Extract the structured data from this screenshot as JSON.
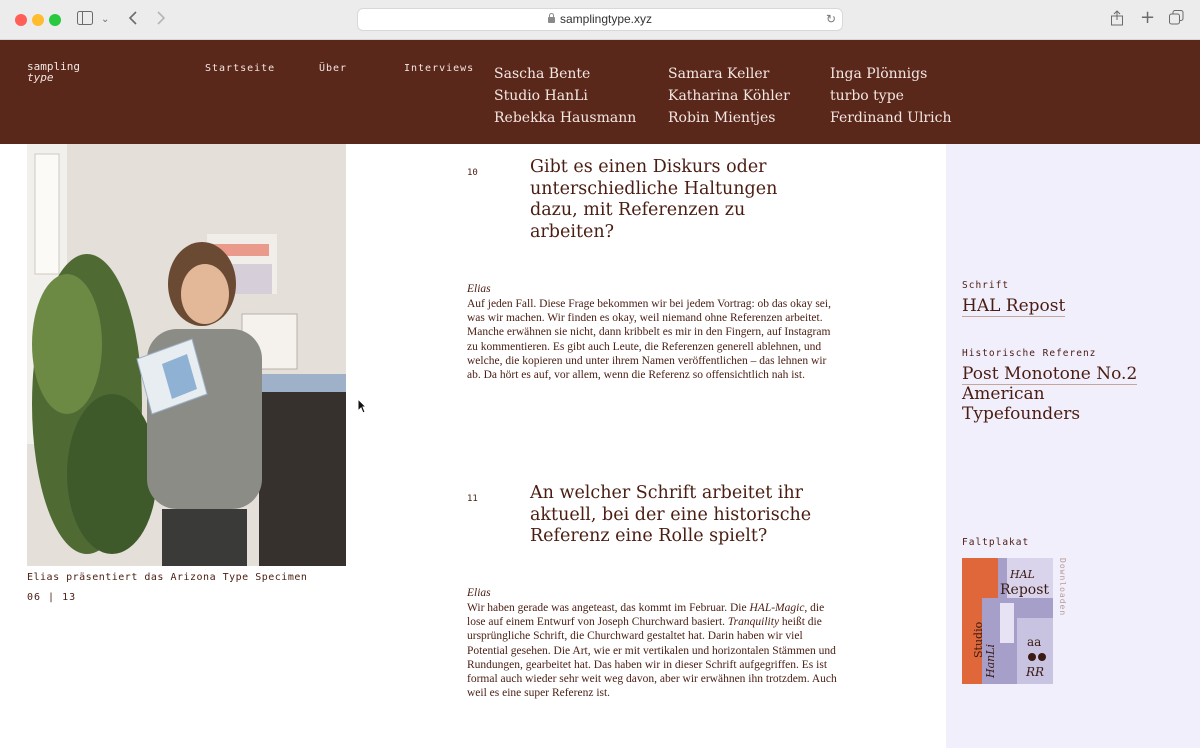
{
  "browser": {
    "url": "samplingtype.xyz"
  },
  "header": {
    "logo_line1": "sampling",
    "logo_line2": "type",
    "nav": [
      "Startseite",
      "Über",
      "Interviews"
    ],
    "studios": [
      [
        "Sascha Bente",
        "Studio HanLi",
        "Rebekka Hausmann"
      ],
      [
        "Samara Keller",
        "Katharina Köhler",
        "Robin Mientjes"
      ],
      [
        "Inga Plönnigs",
        "turbo type",
        "Ferdinand Ulrich"
      ]
    ]
  },
  "photo": {
    "caption": "Elias präsentiert das Arizona Type Specimen",
    "pager": "06 | 13"
  },
  "questions": [
    {
      "number": "10",
      "title": "Gibt es einen Diskurs oder unterschiedliche Haltungen dazu, mit Referenzen zu arbeiten?",
      "speaker": "Elias",
      "answer": "Auf jeden Fall. Diese Frage bekommen wir bei jedem Vortrag: ob das okay sei, was wir machen. Wir finden es okay, weil niemand ohne Referenzen arbeitet. Manche erwähnen sie nicht, dann kribbelt es mir in den Fingern, auf Instagram zu kommentieren. Es gibt auch Leute, die Referenzen generell ablehnen, und welche, die kopieren und unter ihrem Namen veröffentlichen – das lehnen wir ab. Da hört es auf, vor allem, wenn die Referenz so offensichtlich nah ist."
    },
    {
      "number": "11",
      "title": "An welcher Schrift arbeitet ihr aktuell, bei der eine historische Referenz eine Rolle spielt?",
      "speaker": "Elias",
      "answer_parts": [
        "Wir haben gerade was angeteast, das kommt im Februar. Die ",
        "HAL-Magic",
        ", die lose auf einem Entwurf von Joseph Churchward basiert. ",
        "Tranquility",
        " heißt die ursprüngliche Schrift, die Churchward gestaltet hat. Darin haben wir viel Potential gesehen. Die Art, wie er mit vertikalen und horizontalen Stämmen und Rundungen, gearbeitet hat. Das haben wir in dieser Schrift aufgegriffen. Es ist formal auch wieder sehr weit weg davon, aber wir erwähnen ihn trotzdem. Auch weil es eine super Referenz ist."
      ]
    }
  ],
  "sidebar": {
    "font_label": "Schrift",
    "font_value": "HAL Repost",
    "ref_label": "Historische Referenz",
    "ref_line1": "Post Monotone No.2",
    "ref_line2": "American",
    "ref_line3": "Typefounders",
    "poster_label": "Faltplakat",
    "download_label": "Downloaden",
    "poster_text": {
      "title_script": "HAL",
      "title": "Repost",
      "studio1": "Studio",
      "studio2": "HanLi",
      "glyph1": "aa",
      "glyph2": "RR"
    }
  },
  "colors": {
    "header_bg": "#5a271b",
    "text": "#4a1d12",
    "sidebar_bg": "#f1effc",
    "poster_orange": "#e0673a",
    "poster_lilac": "#9f97c3"
  }
}
